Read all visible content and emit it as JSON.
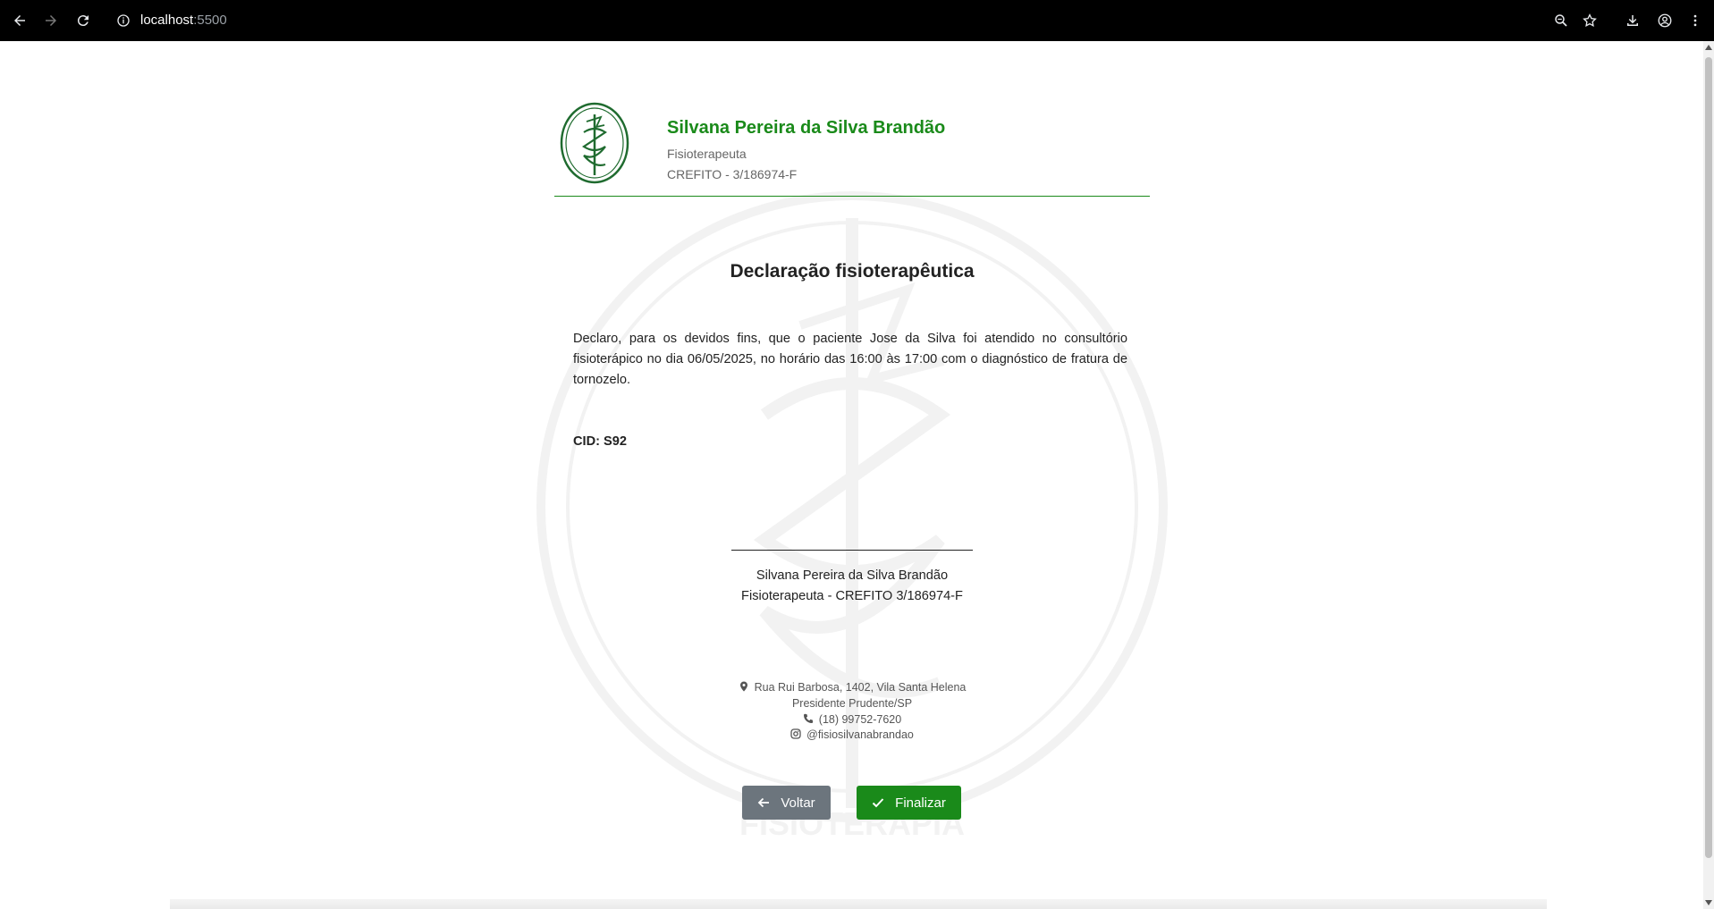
{
  "browser": {
    "url_host": "localhost",
    "url_port": ":5500",
    "icons": [
      "back-icon",
      "forward-icon",
      "reload-icon",
      "info-icon",
      "zoom-icon",
      "star-icon",
      "download-icon",
      "profile-icon",
      "menu-icon"
    ]
  },
  "header": {
    "name": "Silvana Pereira da Silva Brandão",
    "role": "Fisioterapeuta",
    "crefito": "CREFITO - 3/186974-F"
  },
  "document": {
    "title": "Declaração fisioterapêutica",
    "body": "Declaro, para os devidos fins, que o paciente Jose da Silva foi atendido no consultório fisioterápico no dia 06/05/2025, no horário das 16:00 às 17:00 com o diagnóstico de fratura de tornozelo.",
    "cid": "CID: S92"
  },
  "signature": {
    "name": "Silvana Pereira da Silva Brandão",
    "role": "Fisioterapeuta - CREFITO 3/186974-F"
  },
  "footer": {
    "address_line1": "Rua Rui Barbosa, 1402, Vila Santa Helena",
    "address_line2": "Presidente Prudente/SP",
    "phone": "(18) 99752-7620",
    "instagram": "@fisiosilvanabrandao"
  },
  "actions": {
    "back_label": "Voltar",
    "finish_label": "Finalizar"
  },
  "watermark_text": "FISIOTERAPIA",
  "colors": {
    "brand_green": "#1a8a1a",
    "button_gray": "#6c757d",
    "chrome_bg": "#000000"
  }
}
